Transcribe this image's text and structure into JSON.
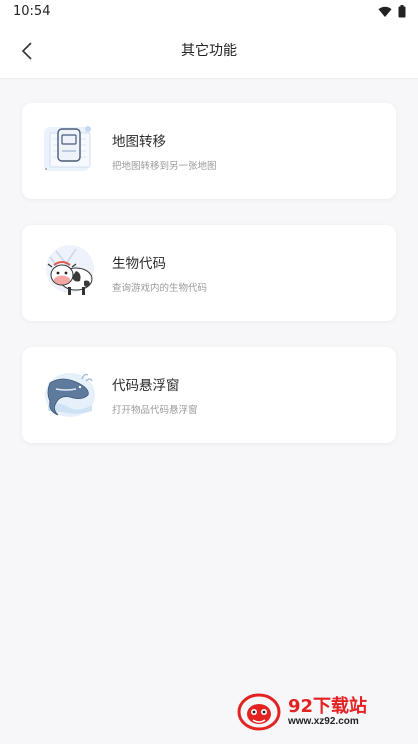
{
  "status_bar": {
    "time": "10:54"
  },
  "header": {
    "title": "其它功能"
  },
  "cards": [
    {
      "title": "地图转移",
      "subtitle": "把地图转移到另一张地图",
      "icon": "map-document-icon"
    },
    {
      "title": "生物代码",
      "subtitle": "查询游戏内的生物代码",
      "icon": "cow-icon"
    },
    {
      "title": "代码悬浮窗",
      "subtitle": "打开物品代码悬浮窗",
      "icon": "whale-icon"
    }
  ],
  "watermark": {
    "brand": "92下载站",
    "url": "www.xz92.com"
  },
  "colors": {
    "background": "#f7f7fa",
    "card": "#ffffff",
    "watermark_red": "#e32222"
  }
}
